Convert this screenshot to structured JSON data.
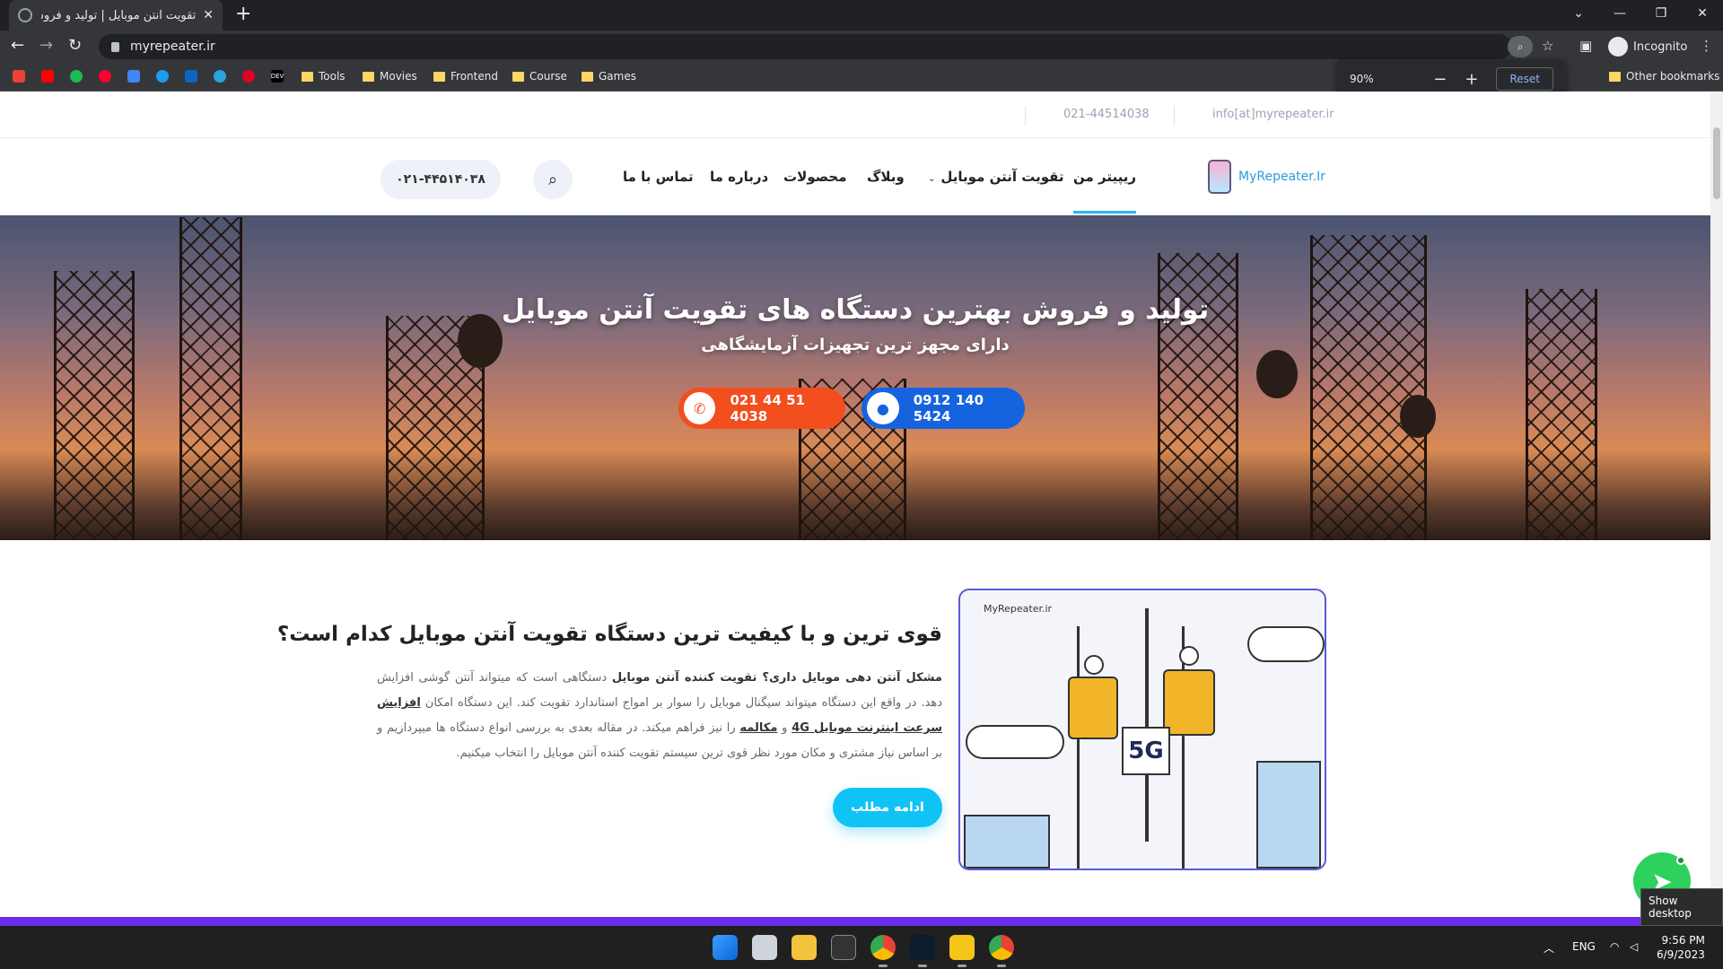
{
  "browser": {
    "tab_title": "تقویت آنتن موبایل | تولید و فروش تقویت کننده آنتن موبایل",
    "tab_close": "✕",
    "new_tab": "+",
    "window_controls": [
      "⌄",
      "—",
      "❐",
      "✕"
    ],
    "url": "myrepeater.ir",
    "incognito_label": "Incognito",
    "bookmarks": [
      {
        "label": "Tools"
      },
      {
        "label": "Movies"
      },
      {
        "label": "Frontend"
      },
      {
        "label": "Course"
      },
      {
        "label": "Games"
      }
    ],
    "bookmark_icons": [
      "gmail-icon",
      "youtube-icon",
      "spotify-icon",
      "youtube-music-icon",
      "translate-icon",
      "twitter-icon",
      "linkedin-icon",
      "telegram-icon",
      "pinterest-icon",
      "dev-icon"
    ],
    "dev_icon_text": "DEV",
    "other_bookmarks": "Other bookmarks",
    "zoom": {
      "value": "90%",
      "minus": "−",
      "plus": "+",
      "reset": "Reset"
    }
  },
  "site": {
    "topbar": {
      "phone": "021-44514038",
      "email": "info[at]myrepeater.ir"
    },
    "logo_text": "MyRepeater.Ir",
    "menu": [
      {
        "label": "ریپیتر من"
      },
      {
        "label": "تقویت آنتن موبایل"
      },
      {
        "label": "وبلاگ"
      },
      {
        "label": "محصولات"
      },
      {
        "label": "درباره ما"
      },
      {
        "label": "تماس با ما"
      }
    ],
    "header_phone": "۰۲۱-۴۴۵۱۴۰۳۸",
    "hero": {
      "title": "تولید و فروش بهترین دستگاه های تقویت آنتن موبایل",
      "subtitle": "دارای مجهز ترین تجهیزات آزمایشگاهی",
      "mobile_button": "0912 140 5424",
      "phone_button": "021 44 51 4038"
    },
    "article": {
      "title": "قوی ترین و با کیفیت ترین دستگاه تقویت آنتن موبایل کدام است؟",
      "p_bold1": "مشکل آنتن دهی موبایل داری؟ تقویت کننده آنتن موبایل",
      "p_text1": " دستگاهی است که میتواند آنتن گوشی افزایش دهد. در واقع این دستگاه میتواند سیگنال موبایل را سوار بر امواج استاندارد تقویت کند. این دستگاه امکان ",
      "p_link1": "افزایش سرعت اینترنت موبایل 4G",
      "p_text2": " و ",
      "p_link2": "مکالمه",
      "p_text3": " را نیز فراهم میکند. در مقاله بعدی به بررسی انواع دستگاه ها میپردازیم و بر اساس نیاز مشتری و مکان مورد نظر قوی ترین سیستم تقویت کننده آنتن موبایل را انتخاب میکنیم.",
      "more_button": "ادامه مطلب"
    },
    "illustration": {
      "label": "MyRepeater.ir",
      "sign": "5G"
    },
    "show_desktop": "Show desktop"
  },
  "taskbar": {
    "lang": "ENG",
    "time": "9:56 PM",
    "date": "6/9/2023",
    "tray_arrow": "︿"
  }
}
